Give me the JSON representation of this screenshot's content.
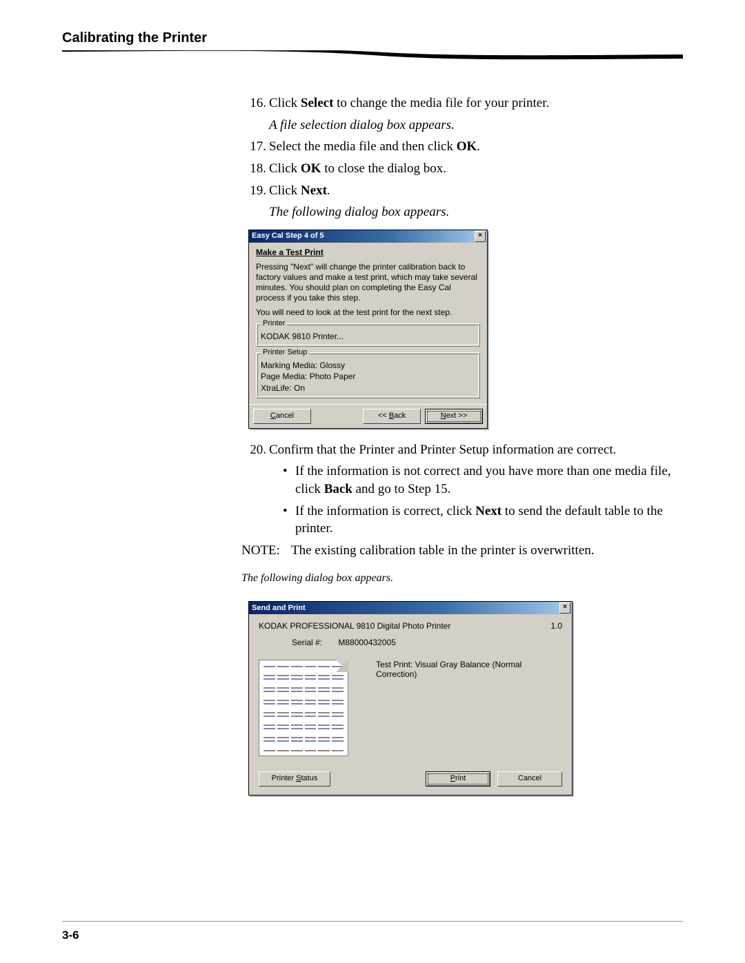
{
  "header": {
    "section_title": "Calibrating the Printer"
  },
  "steps": {
    "s16_num": "16.",
    "s16_text_a": "Click ",
    "s16_bold": "Select",
    "s16_text_b": " to change the media file for your printer.",
    "s16_result": "A file selection dialog box appears.",
    "s17_num": "17.",
    "s17_text_a": "Select the media file and then click ",
    "s17_bold": "OK",
    "s17_text_b": ".",
    "s18_num": "18.",
    "s18_text_a": "Click ",
    "s18_bold": "OK",
    "s18_text_b": " to close the dialog box.",
    "s19_num": "19.",
    "s19_text_a": "Click ",
    "s19_bold": "Next",
    "s19_text_b": ".",
    "s19_result": "The following dialog box appears.",
    "s20_num": "20.",
    "s20_text": "Confirm that the Printer and Printer Setup information are correct.",
    "bullet1_a": "If the information is not correct and you have more than one media file, click ",
    "bullet1_bold": "Back",
    "bullet1_b": " and go to Step 15.",
    "bullet2_a": "If the information is correct, click ",
    "bullet2_bold": "Next",
    "bullet2_b": " to send the default table to the printer.",
    "note_label": "NOTE:",
    "note_text": "The existing calibration table in the printer is overwritten.",
    "after_note_italic": "The following dialog box appears."
  },
  "dialog1": {
    "title": "Easy Cal Step 4 of 5",
    "close_glyph": "×",
    "heading": "Make a Test Print",
    "para1": "Pressing \"Next\" will change the printer calibration back to factory values and make a test print, which may take several minutes.  You should plan on completing the Easy Cal process if you take this step.",
    "para2": "You will need to look at the test print for the next step.",
    "group_printer_legend": "Printer",
    "printer_value": "KODAK 9810 Printer...",
    "group_setup_legend": "Printer Setup",
    "setup_line1": "Marking Media: Glossy",
    "setup_line2": "Page Media: Photo Paper",
    "setup_line3": "XtraLife: On",
    "btn_cancel": "Cancel",
    "btn_back": "<< Back",
    "btn_next": "Next >>",
    "back_u": "B",
    "cancel_u": "C",
    "next_u": "N"
  },
  "dialog2": {
    "title": "Send and Print",
    "close_glyph": "×",
    "printer_name": "KODAK PROFESSIONAL 9810 Digital Photo Printer",
    "version": "1.0",
    "serial_label": "Serial #:",
    "serial_value": "M88000432005",
    "test_print_label": "Test Print: Visual Gray Balance (Normal Correction)",
    "btn_status": "Printer Status",
    "status_u": "S",
    "btn_print": "Print",
    "print_u": "P",
    "btn_cancel": "Cancel"
  },
  "footer": {
    "page_number": "3-6"
  }
}
